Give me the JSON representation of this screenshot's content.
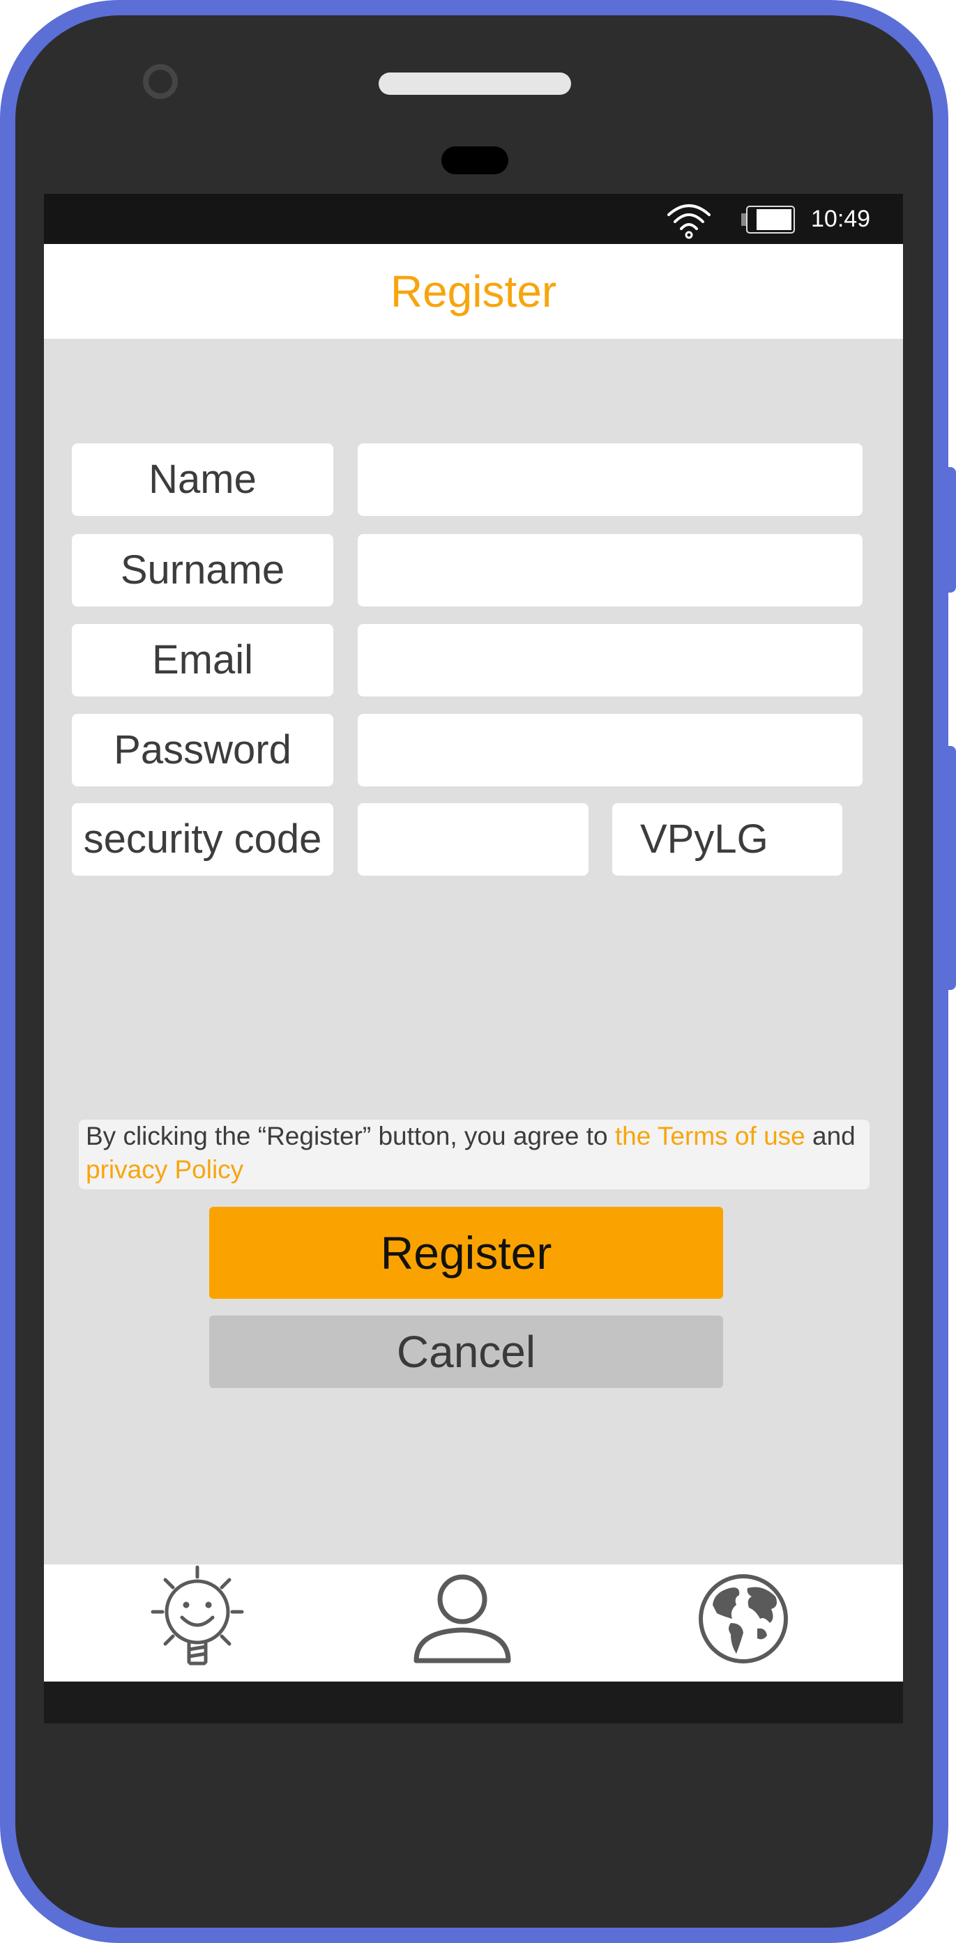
{
  "status_bar": {
    "time": "10:49",
    "icons": [
      "wifi-icon",
      "battery-icon"
    ]
  },
  "header": {
    "title": "Register"
  },
  "form": {
    "name_label": "Name",
    "name_value": "",
    "surname_label": "Surname",
    "surname_value": "",
    "email_label": "Email",
    "email_value": "",
    "password_label": "Password",
    "password_value": "",
    "security_code_label": "security code",
    "security_code_value": "",
    "captcha_text": "VPyLG"
  },
  "terms": {
    "prefix": "By clicking the “Register” button, you agree to ",
    "terms_link": "the Terms of use",
    "middle": " and ",
    "privacy_link": "privacy Policy"
  },
  "actions": {
    "register_label": "Register",
    "cancel_label": "Cancel"
  },
  "tab_bar": {
    "tabs": [
      {
        "icon": "lightbulb-sun-icon"
      },
      {
        "icon": "user-icon"
      },
      {
        "icon": "globe-icon"
      }
    ]
  },
  "colors": {
    "accent": "#f7a50d",
    "register_button": "#faa300",
    "cancel_button": "#c3c3c3",
    "phone_frame": "#5b6fd6",
    "screen_background": "#dfdfdf"
  }
}
